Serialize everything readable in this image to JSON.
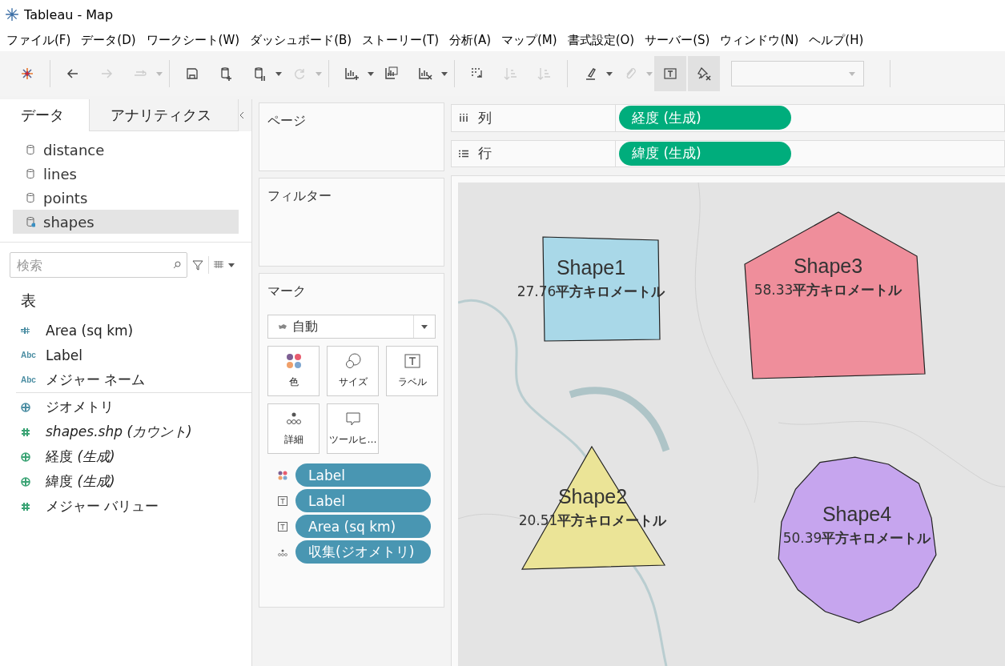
{
  "window": {
    "title": "Tableau - Map"
  },
  "menu": [
    "ファイル(F)",
    "データ(D)",
    "ワークシート(W)",
    "ダッシュボード(B)",
    "ストーリー(T)",
    "分析(A)",
    "マップ(M)",
    "書式設定(O)",
    "サーバー(S)",
    "ウィンドウ(N)",
    "ヘルプ(H)"
  ],
  "toolbar": [
    {
      "kind": "logo",
      "pressed": false,
      "caret": false
    },
    {
      "kind": "back",
      "disabled": false,
      "pressed": false,
      "caret": false
    },
    {
      "kind": "forward",
      "disabled": true,
      "pressed": false,
      "caret": false
    },
    {
      "kind": "redo",
      "disabled": true,
      "pressed": false,
      "caret": true
    },
    {
      "kind": "save",
      "disabled": false,
      "pressed": false,
      "caret": false
    },
    {
      "kind": "add-data",
      "disabled": false,
      "pressed": false,
      "caret": false
    },
    {
      "kind": "pause",
      "disabled": false,
      "pressed": false,
      "caret": true
    },
    {
      "kind": "refresh",
      "disabled": true,
      "pressed": false,
      "caret": true
    },
    {
      "kind": "new-sheet",
      "disabled": false,
      "pressed": false,
      "caret": true
    },
    {
      "kind": "duplicate",
      "disabled": false,
      "pressed": false,
      "caret": false
    },
    {
      "kind": "clear",
      "disabled": false,
      "pressed": false,
      "caret": true
    },
    {
      "kind": "swap",
      "disabled": false,
      "pressed": false,
      "caret": false
    },
    {
      "kind": "sort-asc",
      "disabled": true,
      "pressed": false,
      "caret": false
    },
    {
      "kind": "sort-desc",
      "disabled": true,
      "pressed": false,
      "caret": false
    },
    {
      "kind": "highlight",
      "disabled": false,
      "pressed": false,
      "caret": true
    },
    {
      "kind": "attach",
      "disabled": true,
      "pressed": false,
      "caret": true
    },
    {
      "kind": "labels",
      "disabled": false,
      "pressed": true,
      "caret": false
    },
    {
      "kind": "pin",
      "disabled": false,
      "pressed": true,
      "caret": false
    }
  ],
  "side_tabs": [
    {
      "label": "データ",
      "selected": true
    },
    {
      "label": "アナリティクス",
      "selected": false
    }
  ],
  "data_sources": [
    {
      "name": "distance",
      "selected": false
    },
    {
      "name": "lines",
      "selected": false
    },
    {
      "name": "points",
      "selected": false
    },
    {
      "name": "shapes",
      "selected": true
    }
  ],
  "search": {
    "placeholder": "検索"
  },
  "table_heading": "表",
  "fields": [
    {
      "label": "Area (sq km)",
      "kind": "number-calc",
      "color": "#4c8ea3",
      "italic": false,
      "divider_after": false
    },
    {
      "label": "Label",
      "kind": "text",
      "type_text": "Abc",
      "color": "#4c8ea3",
      "italic": false,
      "divider_after": false
    },
    {
      "label": "メジャー ネーム",
      "kind": "text",
      "type_text": "Abc",
      "color": "#4c8ea3",
      "italic": false,
      "divider_after": true
    },
    {
      "label": "ジオメトリ",
      "kind": "geo",
      "color": "#4c8ea3",
      "italic": false,
      "divider_after": false
    },
    {
      "label": "shapes.shp (カウント)",
      "kind": "number",
      "color": "#3aa374",
      "italic": true,
      "divider_after": false
    },
    {
      "label": "経度 *(生成)*",
      "kind": "geo",
      "color": "#3aa374",
      "italic": false,
      "divider_after": false
    },
    {
      "label": "緯度 *(生成)*",
      "kind": "geo",
      "color": "#3aa374",
      "italic": false,
      "divider_after": false
    },
    {
      "label": "メジャー バリュー",
      "kind": "number",
      "color": "#3aa374",
      "italic": false,
      "divider_after": false
    }
  ],
  "pages": {
    "title": "ページ"
  },
  "filters": {
    "title": "フィルター"
  },
  "marks": {
    "title": "マーク",
    "mark_type": "自動",
    "buttons": [
      {
        "kind": "color",
        "label": "色"
      },
      {
        "kind": "size",
        "label": "サイズ"
      },
      {
        "kind": "label",
        "label": "ラベル"
      },
      {
        "kind": "detail",
        "label": "詳細"
      },
      {
        "kind": "tooltip",
        "label": "ツールヒ…"
      }
    ],
    "pills": [
      {
        "kind": "color",
        "label": "Label"
      },
      {
        "kind": "label",
        "label": "Label"
      },
      {
        "kind": "label",
        "label": "Area (sq km)"
      },
      {
        "kind": "detail",
        "label": "収集(ジオメトリ)"
      }
    ]
  },
  "shelves": [
    {
      "kind": "columns",
      "label": "列",
      "pill": "経度 (生成)"
    },
    {
      "kind": "rows",
      "label": "行",
      "pill": "緯度 (生成)"
    }
  ],
  "map": {
    "shapes": [
      {
        "kind": "rectangle",
        "name": "Shape1",
        "area": "27.76**平方キロメートル**",
        "color": "#a9d8e8"
      },
      {
        "kind": "triangle",
        "name": "Shape2",
        "area": "20.51**平方キロメートル**",
        "color": "#ebe497"
      },
      {
        "kind": "pentagon",
        "name": "Shape3",
        "area": "58.33**平方キロメートル**",
        "color": "#ef8e9b"
      },
      {
        "kind": "circle",
        "name": "Shape4",
        "area": "50.39**平方キロメートル**",
        "color": "#c6a5ee"
      }
    ]
  }
}
